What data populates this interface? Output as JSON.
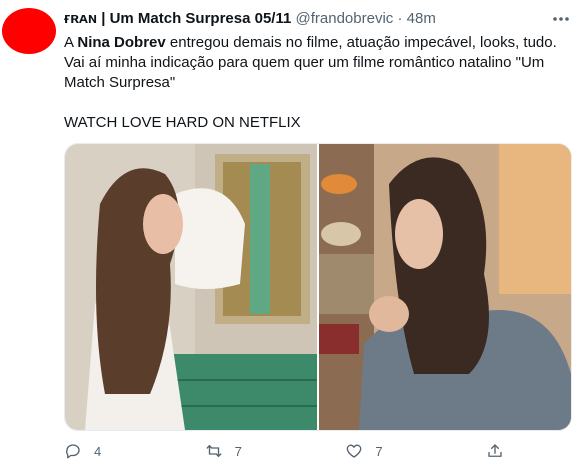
{
  "tweet": {
    "display_name": "ғʀᴀɴ | Um Match Surpresa 05/11",
    "handle": "@frandobrevic",
    "separator": "·",
    "time": "48m",
    "text_part1": "A ",
    "text_bold": "Nina Dobrev",
    "text_part2": " entregou demais no filme, atuação impecável, looks, tudo. Vai aí minha indicação para quem quer um filme romântico natalino \"Um Match Surpresa\"",
    "text_line2": "WATCH LOVE HARD ON NETFLIX"
  },
  "actions": {
    "reply_count": "4",
    "retweet_count": "7",
    "like_count": "7"
  },
  "colors": {
    "avatar": "#ff0000",
    "secondary_text": "#536471",
    "primary_text": "#0f1419"
  },
  "icons": [
    "more-icon",
    "reply-icon",
    "retweet-icon",
    "like-icon",
    "share-icon"
  ]
}
